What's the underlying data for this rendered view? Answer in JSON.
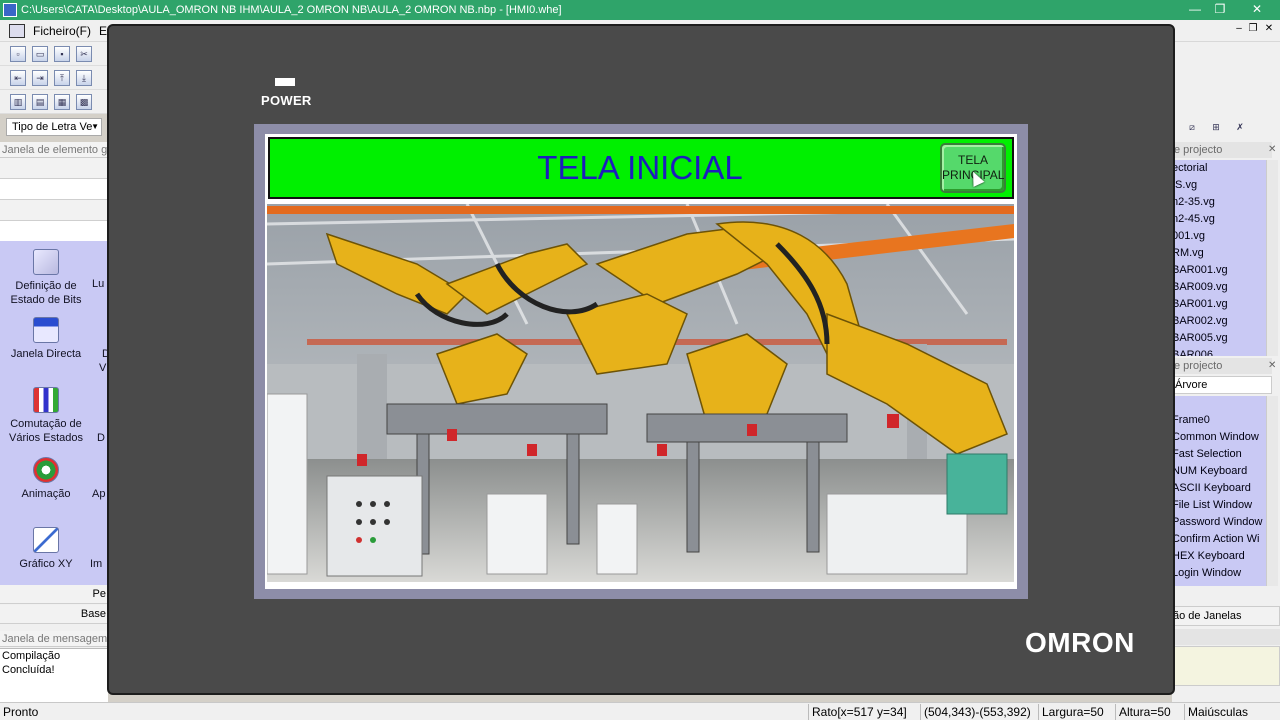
{
  "window": {
    "title": "C:\\Users\\CATA\\Desktop\\AULA_OMRON NB IHM\\AULA_2 OMRON NB\\AULA_2 OMRON NB.nbp - [HMI0.whe]"
  },
  "menu": {
    "items": [
      "Ficheiro(F)",
      "E"
    ]
  },
  "toolbar": {
    "font_select": "Tipo de Letra Ve"
  },
  "left_panel": {
    "title": "Janela de elemento g",
    "tools": [
      {
        "label": "Definição de Estado de Bits",
        "icon": "bit-state-icon"
      },
      {
        "label": "Janela Directa",
        "icon": "direct-window-icon"
      },
      {
        "label": "Comutação de Vários Estados",
        "icon": "multi-state-icon"
      },
      {
        "label": "Animação",
        "icon": "animation-icon"
      },
      {
        "label": "Gráfico XY",
        "icon": "xy-graph-icon"
      }
    ],
    "side_labels": [
      "Lu",
      "D",
      "V",
      "D",
      "Ap",
      "Im"
    ],
    "bottom_buttons": [
      "Pe",
      "Base"
    ],
    "message_title": "Janela de mensagem",
    "message": "Compilação Concluída!"
  },
  "right_panel": {
    "library_title": "e projecto",
    "library_items": [
      "ectorial",
      "IS.vg",
      "n2-35.vg",
      "n2-45.vg",
      "001.vg",
      "RM.vg",
      "BAR001.vg",
      "BAR009.vg",
      "BAR001.vg",
      "BAR002.vg",
      "BAR005.vg",
      "BAR006"
    ],
    "project_title": "e projecto",
    "tree_tab": "Árvore",
    "project_items": [
      "Frame0",
      "Common Window",
      "Fast Selection",
      "NUM Keyboard",
      "ASCII Keyboard",
      "File List Window",
      "Password Window",
      "Confirm Action Wi",
      "HEX Keyboard",
      "Login Window"
    ],
    "bottom_button": "ão de Janelas"
  },
  "hmi": {
    "power_label": "POWER",
    "brand": "OMRON",
    "screen_title": "TELA INICIAL",
    "nav_button": "TELA PRINCIPAL",
    "image_alt": "Linha de robôs industriais amarelos"
  },
  "status": {
    "ready": "Pronto",
    "ratio": "Rato[x=517  y=34]",
    "coords": "(504,343)-(553,392)",
    "width": "Largura=50",
    "height": "Altura=50",
    "caps": "Maiúsculas"
  },
  "colors": {
    "titlebar": "#2fa46a",
    "device": "#4a4a4a",
    "header_green": "#00f000",
    "title_blue": "#1d1dbd",
    "tool_panel": "#c9c9f4"
  }
}
